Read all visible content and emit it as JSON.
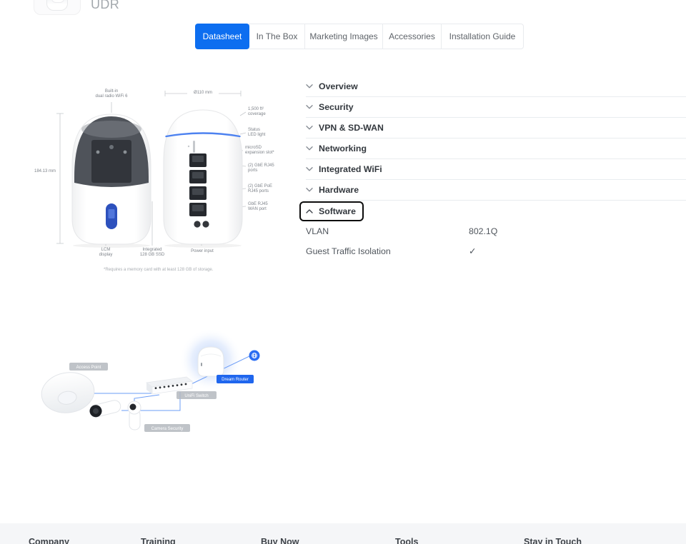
{
  "header": {
    "product_code": "UDR"
  },
  "tabs": [
    {
      "label": "Datasheet",
      "active": true
    },
    {
      "label": "In The Box",
      "active": false
    },
    {
      "label": "Marketing Images",
      "active": false
    },
    {
      "label": "Accessories",
      "active": false
    },
    {
      "label": "Installation Guide",
      "active": false
    }
  ],
  "colors": {
    "accent_blue": "#0d6ef0",
    "router_label_blue": "#1f66ee",
    "status_led_blue": "#4d82f0",
    "footer_bg": "#f5f6f8",
    "divider": "#e9ecef"
  },
  "diagram": {
    "labels": {
      "builtin": "Built-in\ndual radio WiFi 6",
      "height": "184.13 mm",
      "diameter": "Ø110 mm",
      "coverage": "1,500 ft²\ncoverage",
      "status_led": "Status\nLED light",
      "microsd": "microSD\nexpansion slot*",
      "gbe_ports": "(2) GbE RJ45\nports",
      "poe_ports": "(2) GbE PoE\nRJ45 ports",
      "wan_port": "GbE RJ45\nWAN port",
      "lcm": "LCM\ndisplay",
      "ssd": "Integrated\n128 GB SSD",
      "power": "Power input",
      "footnote": "*Requires a memory card with at least 128 GB of storage."
    }
  },
  "specs": {
    "sections": [
      {
        "label": "Overview",
        "expanded": false
      },
      {
        "label": "Security",
        "expanded": false
      },
      {
        "label": "VPN & SD-WAN",
        "expanded": false
      },
      {
        "label": "Networking",
        "expanded": false
      },
      {
        "label": "Integrated WiFi",
        "expanded": false
      },
      {
        "label": "Hardware",
        "expanded": false
      },
      {
        "label": "Software",
        "expanded": true,
        "focused": true
      }
    ],
    "rows": [
      {
        "label": "VLAN",
        "value": "802.1Q"
      },
      {
        "label": "Guest Traffic Isolation",
        "value": "✓"
      }
    ]
  },
  "topology": {
    "labels": {
      "access_point": "Access Point",
      "switch": "UniFi Switch",
      "router": "Dream Router",
      "camera": "Camera Security"
    }
  },
  "footer": {
    "columns": [
      "Company",
      "Training",
      "Buy Now",
      "Tools",
      "Stay in Touch"
    ]
  }
}
